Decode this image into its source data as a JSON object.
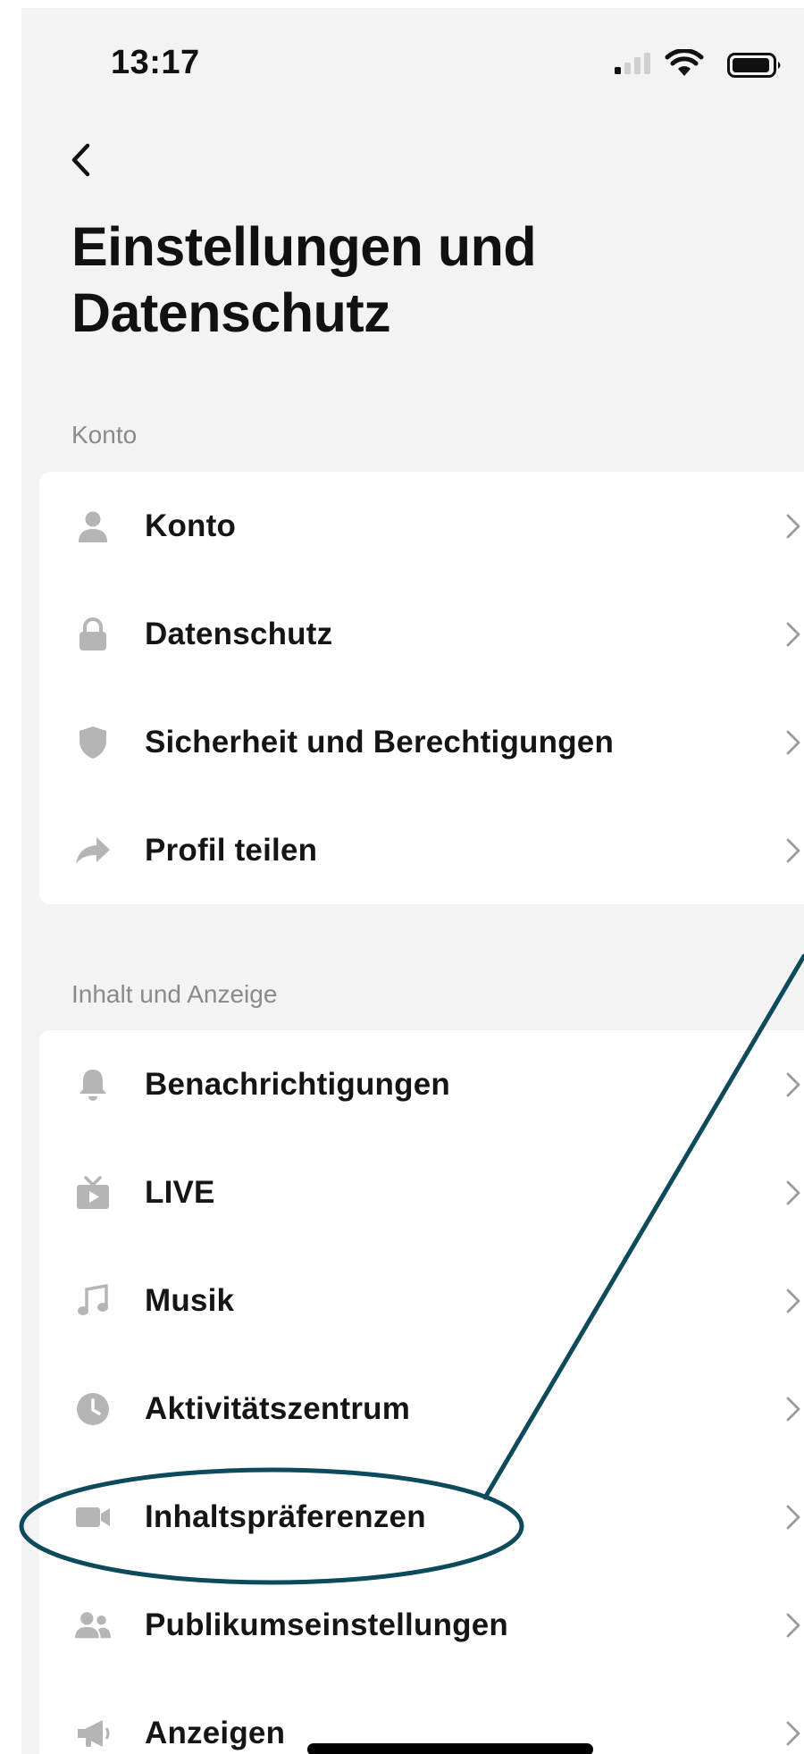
{
  "status_bar": {
    "time": "13:17"
  },
  "page": {
    "title": "Einstellungen und Datenschutz"
  },
  "sections": [
    {
      "label": "Konto",
      "items": [
        {
          "label": "Konto",
          "icon": "person-icon"
        },
        {
          "label": "Datenschutz",
          "icon": "lock-icon"
        },
        {
          "label": "Sicherheit und Berechtigungen",
          "icon": "shield-icon"
        },
        {
          "label": "Profil teilen",
          "icon": "share-arrow-icon"
        }
      ]
    },
    {
      "label": "Inhalt und Anzeige",
      "items": [
        {
          "label": "Benachrichtigungen",
          "icon": "bell-icon"
        },
        {
          "label": "LIVE",
          "icon": "tv-icon"
        },
        {
          "label": "Musik",
          "icon": "music-note-icon"
        },
        {
          "label": "Aktivitätszentrum",
          "icon": "clock-icon"
        },
        {
          "label": "Inhaltspräferenzen",
          "icon": "video-camera-icon",
          "highlighted": true
        },
        {
          "label": "Publikumseinstellungen",
          "icon": "audience-icon"
        },
        {
          "label": "Anzeigen",
          "icon": "megaphone-icon"
        }
      ]
    }
  ],
  "colors": {
    "background": "#f3f3f3",
    "card": "#ffffff",
    "icon": "#b5b5b5",
    "annotation": "#0d4a5c",
    "section_label": "#8a8a8a"
  }
}
